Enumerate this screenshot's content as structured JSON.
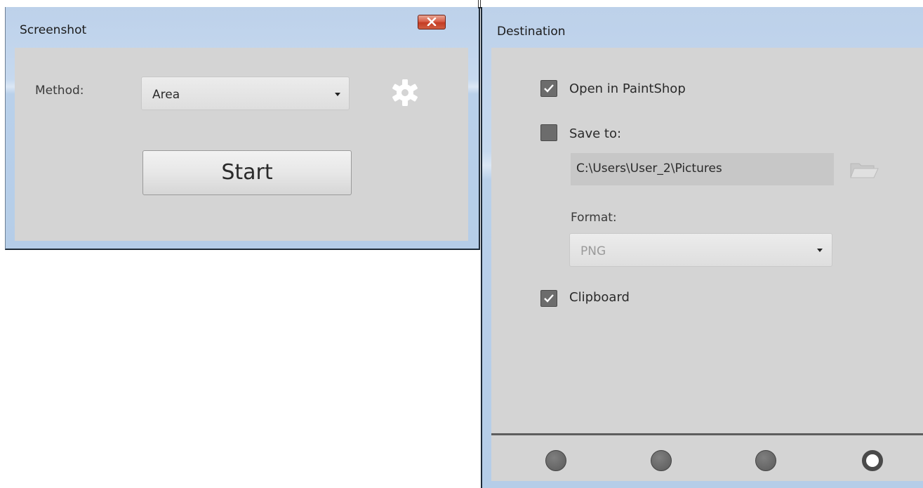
{
  "screenshot_window": {
    "title": "Screenshot",
    "method_label": "Method:",
    "method_value": "Area",
    "start_label": "Start"
  },
  "destination_window": {
    "title": "Destination",
    "open_in_paintshop": {
      "label": "Open in PaintShop",
      "checked": true
    },
    "save_to": {
      "label": "Save to:",
      "checked": false,
      "path": "C:\\Users\\User_2\\Pictures"
    },
    "format_label": "Format:",
    "format_value": "PNG",
    "clipboard": {
      "label": "Clipboard",
      "checked": true
    },
    "pages": {
      "count": 4,
      "active_index": 3
    }
  },
  "colors": {
    "frame": "#b5cde8",
    "client": "#d4d4d4",
    "close_button": "#c43c24"
  }
}
